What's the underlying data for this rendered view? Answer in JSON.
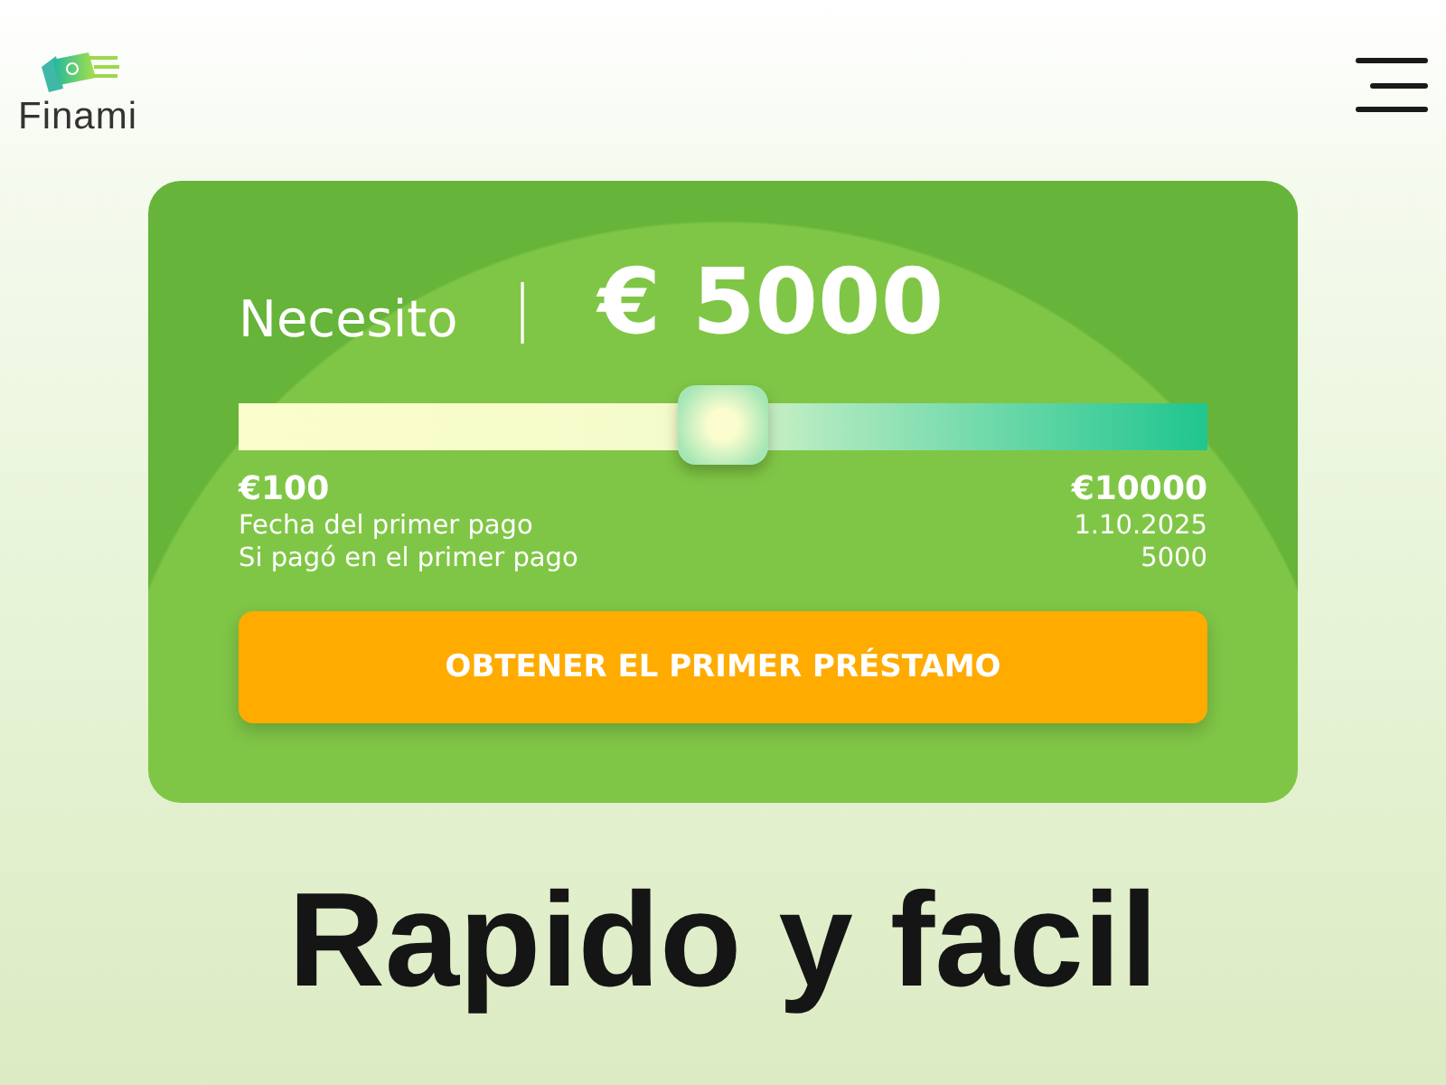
{
  "header": {
    "logo": "Finami"
  },
  "calculator": {
    "label": "Necesito",
    "separator": "|",
    "amount": "€ 5000",
    "slider": {
      "level": 0.5
    },
    "min": "€100",
    "max": "€10000",
    "details": [
      {
        "label": "Fecha del primer pago",
        "value": "1.10.2025"
      },
      {
        "label": "Si pagó en el primer pago",
        "value": "5000"
      }
    ],
    "button": "OBTENER EL PRIMER PRÉSTAMO"
  },
  "headline": "Rapido y facil"
}
